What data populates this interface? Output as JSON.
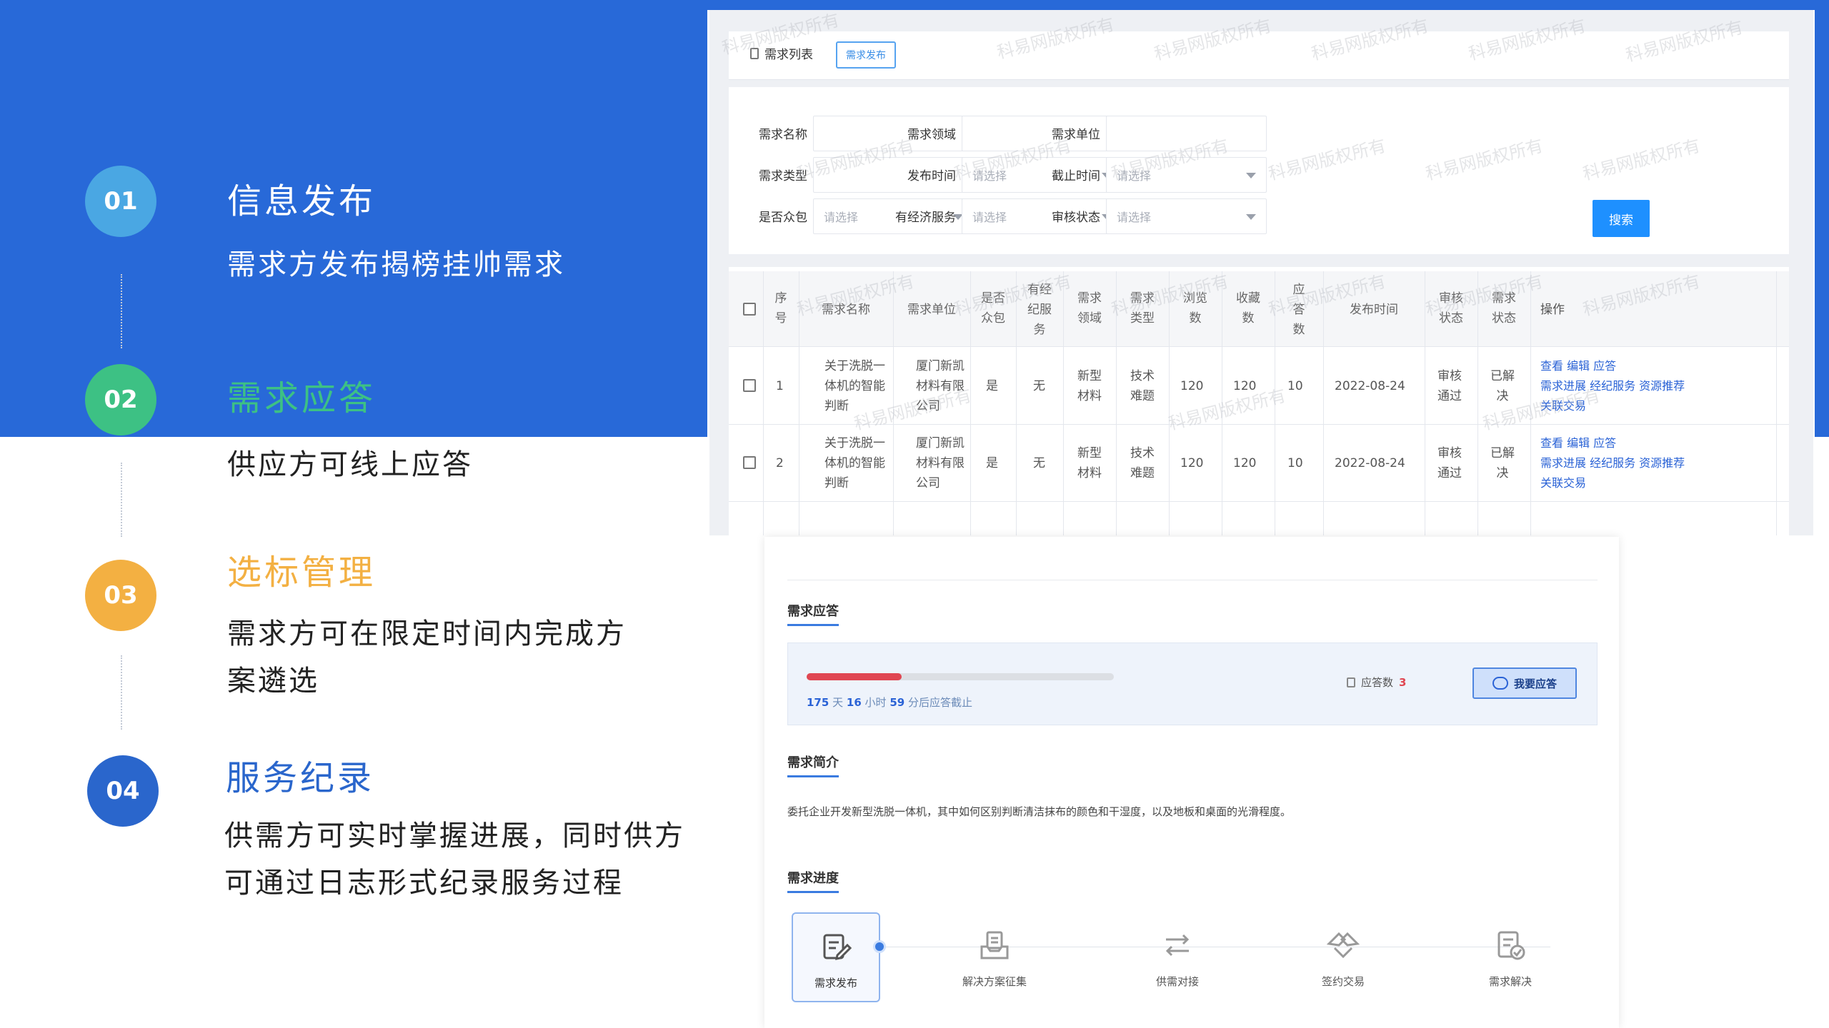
{
  "colors": {
    "brand_blue": "#2869d8",
    "step1": "#4aa7e3",
    "step2": "#3dc184",
    "step3": "#f3b042",
    "step4": "#2a66cc",
    "link_blue": "#2b63d6",
    "progress_red": "#e04652"
  },
  "steps": [
    {
      "num": "01",
      "title": "信息发布",
      "desc": "需求方发布揭榜挂帅需求"
    },
    {
      "num": "02",
      "title": "需求应答",
      "desc": "供应方可线上应答"
    },
    {
      "num": "03",
      "title": "选标管理",
      "desc_lines": [
        "需求方可在限定时间内完成方",
        "案遴选"
      ]
    },
    {
      "num": "04",
      "title": "服务纪录",
      "desc_lines": [
        "供需方可实时掌握进展，同时供方",
        "可通过日志形式纪录服务过程"
      ]
    }
  ],
  "list_panel": {
    "tab_label": "需求列表",
    "tab_button": "需求发布",
    "filters": {
      "name_label": "需求名称",
      "field_label": "需求领域",
      "unit_label": "需求单位",
      "type_label": "需求类型",
      "type_placeholder": "请选择",
      "publish_label": "发布时间",
      "publish_placeholder": "请选择",
      "deadline_label": "截止时间",
      "deadline_placeholder": "请选择",
      "crowd_label": "是否众包",
      "crowd_placeholder": "请选择",
      "econ_label": "有经济服务",
      "econ_placeholder": "请选择",
      "audit_label": "审核状态",
      "audit_placeholder": "请选择",
      "search_button": "搜索"
    },
    "columns": {
      "no": [
        "序",
        "号"
      ],
      "name": "需求名称",
      "unit": "需求单位",
      "crowd": [
        "是否",
        "众包"
      ],
      "econ": [
        "有经",
        "纪服",
        "务"
      ],
      "field": [
        "需求",
        "领域"
      ],
      "type": [
        "需求",
        "类型"
      ],
      "views": [
        "浏览",
        "数"
      ],
      "favs": [
        "收藏",
        "数"
      ],
      "answers": [
        "应",
        "答",
        "数"
      ],
      "date": "发布时间",
      "audit": [
        "审核",
        "状态"
      ],
      "status": [
        "需求",
        "状态"
      ],
      "ops": "操作"
    },
    "rows": [
      {
        "no": "1",
        "name": [
          "关于洗脱一",
          "体机的智能",
          "判断"
        ],
        "unit": [
          "厦门新凯",
          "材料有限",
          "公司"
        ],
        "crowd": "是",
        "econ": "无",
        "field": [
          "新型",
          "材料"
        ],
        "type": [
          "技术",
          "难题"
        ],
        "views": "120",
        "favs": "120",
        "answers": "10",
        "date": "2022-08-24",
        "audit": [
          "审核",
          "通过"
        ],
        "status": [
          "已解",
          "决"
        ],
        "ops": [
          "查看 编辑 应答",
          "需求进展 经纪服务 资源推荐",
          "关联交易"
        ]
      },
      {
        "no": "2",
        "name": [
          "关于洗脱一",
          "体机的智能",
          "判断"
        ],
        "unit": [
          "厦门新凯",
          "材料有限",
          "公司"
        ],
        "crowd": "是",
        "econ": "无",
        "field": [
          "新型",
          "材料"
        ],
        "type": [
          "技术",
          "难题"
        ],
        "views": "120",
        "favs": "120",
        "answers": "10",
        "date": "2022-08-24",
        "audit": [
          "审核",
          "通过"
        ],
        "status": [
          "已解",
          "决"
        ],
        "ops": [
          "查看 编辑 应答",
          "需求进展 经纪服务 资源推荐",
          "关联交易"
        ]
      }
    ],
    "watermark": "科易网版权所有"
  },
  "detail_panel": {
    "response_title": "需求应答",
    "progress_fraction": 0.31,
    "countdown": {
      "days": "175",
      "days_unit": "天",
      "hours": "16",
      "hours_unit": "小时",
      "minutes": "59",
      "suffix": "分后应答截止"
    },
    "response_count_label": "应答数",
    "response_count": "3",
    "response_button": "我要应答",
    "intro_title": "需求简介",
    "intro_text": "委托企业开发新型洗脱一体机，其中如何区别判断清洁抹布的颜色和干湿度，以及地板和桌面的光滑程度。",
    "progress_title": "需求进度",
    "stages": [
      {
        "label": "需求发布",
        "icon": "edit-doc-icon",
        "active": true
      },
      {
        "label": "解决方案征集",
        "icon": "inbox-icon",
        "active": false
      },
      {
        "label": "供需对接",
        "icon": "swap-icon",
        "active": false
      },
      {
        "label": "签约交易",
        "icon": "handshake-icon",
        "active": false
      },
      {
        "label": "需求解决",
        "icon": "check-doc-icon",
        "active": false
      }
    ]
  }
}
